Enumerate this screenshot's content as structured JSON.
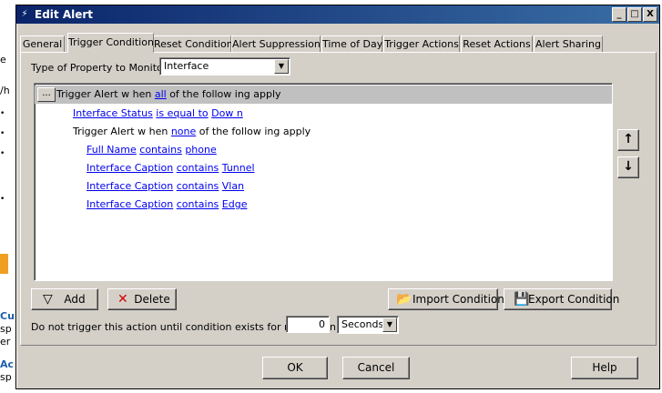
{
  "background": {
    "fragments": [
      "e",
      "/h",
      "Cu",
      "sp",
      "er",
      "Ac",
      "sp"
    ],
    "bullet": "•"
  },
  "window": {
    "title": "Edit Alert",
    "icon": "lightning-icon",
    "controls": {
      "minimize": "_",
      "maximize": "□",
      "close": "X"
    }
  },
  "tabs": [
    {
      "label": "General"
    },
    {
      "label": "Trigger Condition"
    },
    {
      "label": "Reset Condition"
    },
    {
      "label": "Alert Suppression"
    },
    {
      "label": "Time of Day"
    },
    {
      "label": "Trigger Actions"
    },
    {
      "label": "Reset Actions"
    },
    {
      "label": "Alert Sharing"
    }
  ],
  "active_tab": "Trigger Condition",
  "property": {
    "label": "Type of Property to Monitor:",
    "value": "Interface"
  },
  "conditions": {
    "root": {
      "button": "...",
      "prefix": "Trigger Alert w hen",
      "quantifier": "all",
      "suffix": "of the follow ing apply"
    },
    "rule1": {
      "field": "Interface Status",
      "op": "is equal to",
      "value": "Dow n"
    },
    "group": {
      "prefix": "Trigger Alert w hen",
      "quantifier": "none",
      "suffix": "of the follow ing apply"
    },
    "rule2": {
      "field": "Full Name",
      "op": "contains",
      "value": "phone"
    },
    "rule3": {
      "field": "Interface Caption",
      "op": "contains",
      "value": "Tunnel"
    },
    "rule4": {
      "field": "Interface Caption",
      "op": "contains",
      "value": "Vlan"
    },
    "rule5": {
      "field": "Interface Caption",
      "op": "contains",
      "value": "Edge"
    }
  },
  "move": {
    "up": "↑",
    "down": "↓"
  },
  "actions": {
    "add": "Add",
    "delete": "Delete",
    "import": "Import Condition",
    "export": "Export Condition"
  },
  "delay": {
    "label": "Do not trigger this action until condition exists for more than",
    "value": "0",
    "unit": "Seconds"
  },
  "footer": {
    "ok": "OK",
    "cancel": "Cancel",
    "help": "Help"
  },
  "colors": {
    "title_start": "#0a246a",
    "title_end": "#3a6ea5",
    "face": "#d4d0c8",
    "link": "#0000ee",
    "selection": "#c0c0c0"
  }
}
